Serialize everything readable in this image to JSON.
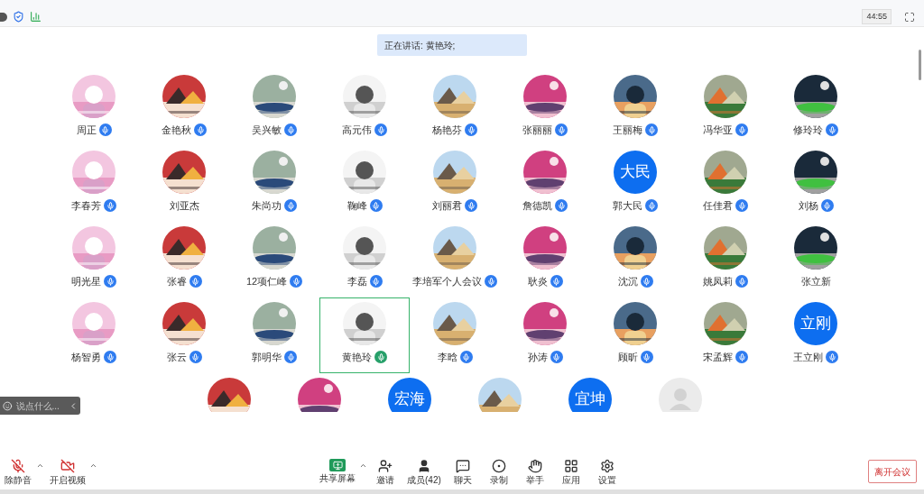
{
  "timer": "44:55",
  "speaker_banner": "正在讲话: 黄艳玲;",
  "participants": [
    {
      "name": "周正",
      "kind": "picture",
      "mic": true,
      "speaking": false
    },
    {
      "name": "金艳秋",
      "kind": "picture",
      "mic": true,
      "speaking": false
    },
    {
      "name": "吴兴敏",
      "kind": "picture",
      "mic": true,
      "speaking": false
    },
    {
      "name": "高元伟",
      "kind": "picture",
      "mic": true,
      "speaking": false
    },
    {
      "name": "杨艳芬",
      "kind": "picture",
      "mic": true,
      "speaking": false
    },
    {
      "name": "张丽丽",
      "kind": "picture",
      "mic": true,
      "speaking": false
    },
    {
      "name": "王丽梅",
      "kind": "picture",
      "mic": true,
      "speaking": false
    },
    {
      "name": "冯华亚",
      "kind": "picture",
      "mic": true,
      "speaking": false
    },
    {
      "name": "修玲玲",
      "kind": "picture",
      "mic": true,
      "speaking": false
    },
    {
      "name": "李春芳",
      "kind": "picture",
      "mic": true,
      "speaking": false
    },
    {
      "name": "刘亚杰",
      "kind": "picture",
      "mic": false,
      "speaking": false
    },
    {
      "name": "朱尚功",
      "kind": "picture",
      "mic": true,
      "speaking": false
    },
    {
      "name": "鞠峰",
      "kind": "picture",
      "mic": true,
      "speaking": false
    },
    {
      "name": "刘丽君",
      "kind": "picture",
      "mic": true,
      "speaking": false
    },
    {
      "name": "詹德凯",
      "kind": "picture",
      "mic": true,
      "speaking": false
    },
    {
      "name": "郭大民",
      "kind": "text",
      "avatar_text": "大民",
      "mic": true,
      "speaking": false
    },
    {
      "name": "任佳君",
      "kind": "picture",
      "mic": true,
      "speaking": false
    },
    {
      "name": "刘杨",
      "kind": "picture",
      "mic": true,
      "speaking": false
    },
    {
      "name": "明光星",
      "kind": "picture",
      "mic": true,
      "speaking": false
    },
    {
      "name": "张睿",
      "kind": "picture",
      "mic": true,
      "speaking": false
    },
    {
      "name": "12项仁峰",
      "kind": "picture",
      "mic": true,
      "speaking": false
    },
    {
      "name": "李磊",
      "kind": "picture",
      "mic": true,
      "speaking": false
    },
    {
      "name": "李培军个人会议",
      "kind": "picture",
      "mic": true,
      "speaking": false
    },
    {
      "name": "耿炎",
      "kind": "picture",
      "mic": true,
      "speaking": false
    },
    {
      "name": "沈沉",
      "kind": "picture",
      "mic": true,
      "speaking": false
    },
    {
      "name": "姚凤莉",
      "kind": "picture",
      "mic": true,
      "speaking": false
    },
    {
      "name": "张立新",
      "kind": "picture",
      "mic": false,
      "speaking": false
    },
    {
      "name": "杨智勇",
      "kind": "picture",
      "mic": true,
      "speaking": false
    },
    {
      "name": "张云",
      "kind": "picture",
      "mic": true,
      "speaking": false
    },
    {
      "name": "郭明华",
      "kind": "picture",
      "mic": true,
      "speaking": false
    },
    {
      "name": "黄艳玲",
      "kind": "picture",
      "mic": true,
      "speaking": true
    },
    {
      "name": "李晗",
      "kind": "picture",
      "mic": true,
      "speaking": false
    },
    {
      "name": "孙涛",
      "kind": "picture",
      "mic": true,
      "speaking": false
    },
    {
      "name": "顾昕",
      "kind": "picture",
      "mic": true,
      "speaking": false
    },
    {
      "name": "宋孟辉",
      "kind": "picture",
      "mic": true,
      "speaking": false
    },
    {
      "name": "王立刚",
      "kind": "text",
      "avatar_text": "立刚",
      "mic": true,
      "speaking": false
    }
  ],
  "partial_row": [
    {
      "kind": "picture"
    },
    {
      "kind": "picture"
    },
    {
      "kind": "text",
      "avatar_text": "宏海"
    },
    {
      "kind": "picture"
    },
    {
      "kind": "text",
      "avatar_text": "宜坤"
    },
    {
      "kind": "default"
    }
  ],
  "chat": {
    "placeholder": "说点什么..."
  },
  "toolbar_left": [
    {
      "kind": "mic-off",
      "label": "除静音",
      "has_menu": true
    },
    {
      "kind": "video-off",
      "label": "开启视频",
      "has_menu": true
    }
  ],
  "toolbar_center": [
    {
      "kind": "share",
      "label": "共享屏幕",
      "has_menu": true
    },
    {
      "kind": "invite",
      "label": "邀请",
      "has_menu": false
    },
    {
      "kind": "members",
      "label": "成员(42)",
      "has_menu": false
    },
    {
      "kind": "chat",
      "label": "聊天",
      "has_menu": false
    },
    {
      "kind": "record",
      "label": "录制",
      "has_menu": false
    },
    {
      "kind": "hand",
      "label": "举手",
      "has_menu": false
    },
    {
      "kind": "apps",
      "label": "应用",
      "has_menu": false
    },
    {
      "kind": "settings",
      "label": "设置",
      "has_menu": false
    }
  ],
  "leave_button": "离开会议"
}
